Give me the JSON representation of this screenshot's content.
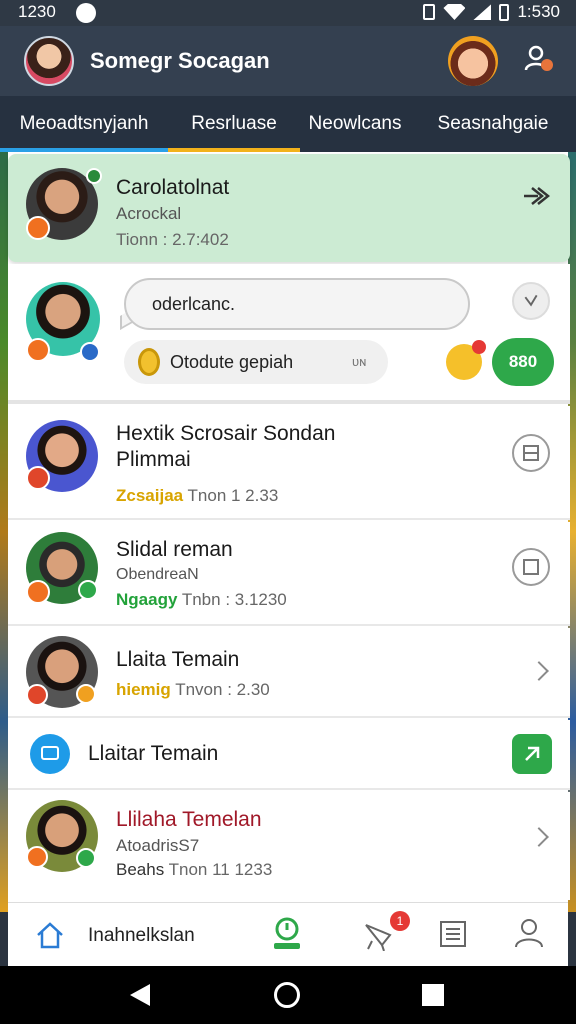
{
  "status_bar": {
    "time_left": "1230",
    "time_right": "1:530"
  },
  "header": {
    "title": "Somegr Socagan"
  },
  "tabs": [
    {
      "label": "Meoadtsnyjanh"
    },
    {
      "label": "Resrluase"
    },
    {
      "label": "Neowlcans"
    },
    {
      "label": "Seasnahgaie"
    }
  ],
  "featured": {
    "name": "Carolatolnat",
    "subtitle": "Acrockal",
    "meta": "Tionn : 2.7:402"
  },
  "chat": {
    "message": "oderlcanc.",
    "option_label": "Otodute gepiah",
    "option_right": "ᴜɴ",
    "action_value": "880"
  },
  "contacts": [
    {
      "name_line1": "Hextik Scrosair Sondan",
      "name_line2": "Plimmai",
      "tag": "Zcsaijaa",
      "time": "Tnon 1 2.33",
      "tag_color": "yellow"
    },
    {
      "name_line1": "Slidal reman",
      "subtitle": "ObendreaN",
      "tag": "Ngaagy",
      "time": "Tnbn : 3.1230",
      "tag_color": "green"
    },
    {
      "name_line1": "Llaita Temain",
      "tag": "hiemig",
      "time": "Tnvon : 2.30",
      "tag_color": "yellow"
    },
    {
      "name_line1": "Llaitar Temain"
    },
    {
      "name_line1": "Llilaha Temelan",
      "subtitle": "AtoadrisS7",
      "tag": "Beahs",
      "time": "Tnon 11 1233"
    }
  ],
  "bottom_nav": {
    "home_label": "Inahnelkslan",
    "notif_count": "1"
  },
  "colors": {
    "accent_blue": "#2aa0e6",
    "accent_yellow": "#f2b21b",
    "green": "#2ea84a",
    "featured_bg": "#ccebd3"
  }
}
